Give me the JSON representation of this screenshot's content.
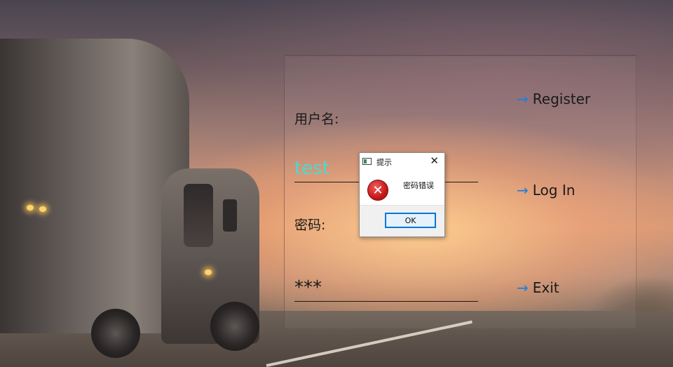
{
  "form": {
    "username_label": "用户名:",
    "username_value": "test",
    "password_label": "密码:",
    "password_value": "***"
  },
  "links": {
    "register": "Register",
    "login": "Log In",
    "exit": "Exit",
    "arrow": "→"
  },
  "dialog": {
    "title": "提示",
    "close": "✕",
    "message": "密码错误",
    "ok_label": "OK",
    "error_icon": "✕"
  },
  "colors": {
    "username_text": "#4fd8d0",
    "link_arrow": "#1e7fd8",
    "ok_border": "#0078d7",
    "error_red": "#c81818"
  }
}
